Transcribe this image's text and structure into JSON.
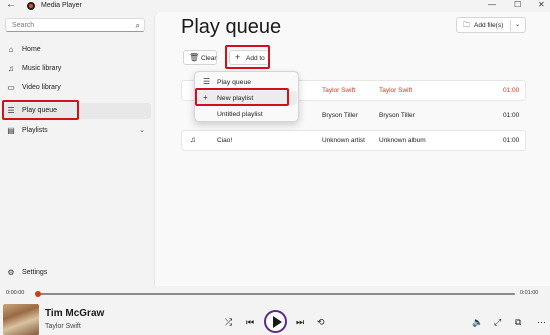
{
  "window": {
    "title": "Media Player",
    "controls": {
      "minimize": "—",
      "maximize": "☐",
      "close": "✕"
    }
  },
  "sidebar": {
    "search_placeholder": "Search",
    "items": [
      {
        "label": "Home",
        "icon": "home-icon",
        "glyph": "⌂"
      },
      {
        "label": "Music library",
        "icon": "music-library-icon",
        "glyph": "♫"
      },
      {
        "label": "Video library",
        "icon": "video-library-icon",
        "glyph": "▭"
      },
      {
        "label": "Play queue",
        "icon": "play-queue-icon",
        "glyph": "☰",
        "active": true
      },
      {
        "label": "Playlists",
        "icon": "playlists-icon",
        "glyph": "▤"
      }
    ],
    "settings_label": "Settings"
  },
  "main": {
    "title": "Play queue",
    "add_files_label": "Add file(s)",
    "clear_label": "Clear",
    "add_to_label": "Add to",
    "tracks": [
      {
        "title": "",
        "artist": "Taylor Swift",
        "album": "Taylor Swift",
        "duration": "01:00",
        "playing": true
      },
      {
        "title": "",
        "artist": "Bryson Tiller",
        "album": "Bryson Tiller",
        "duration": "01:00"
      },
      {
        "title": "Ciao!",
        "artist": "Unknown artist",
        "album": "Unknown album",
        "duration": "01:00"
      }
    ]
  },
  "add_to_menu": {
    "items": [
      {
        "label": "Play queue",
        "icon": "play-queue-icon",
        "glyph": "☰"
      },
      {
        "label": "New playlist",
        "icon": "plus-icon",
        "glyph": "+"
      },
      {
        "label": "Untitled playlist",
        "icon": "",
        "glyph": ""
      }
    ]
  },
  "player": {
    "elapsed": "0:00:00",
    "total": "0:01:00",
    "progress": 0,
    "song_title": "Tim McGraw",
    "song_artist": "Taylor Swift"
  },
  "colors": {
    "accent": "#c4411a",
    "highlight": "#d0101a",
    "play_ring": "#5b2b8a"
  }
}
